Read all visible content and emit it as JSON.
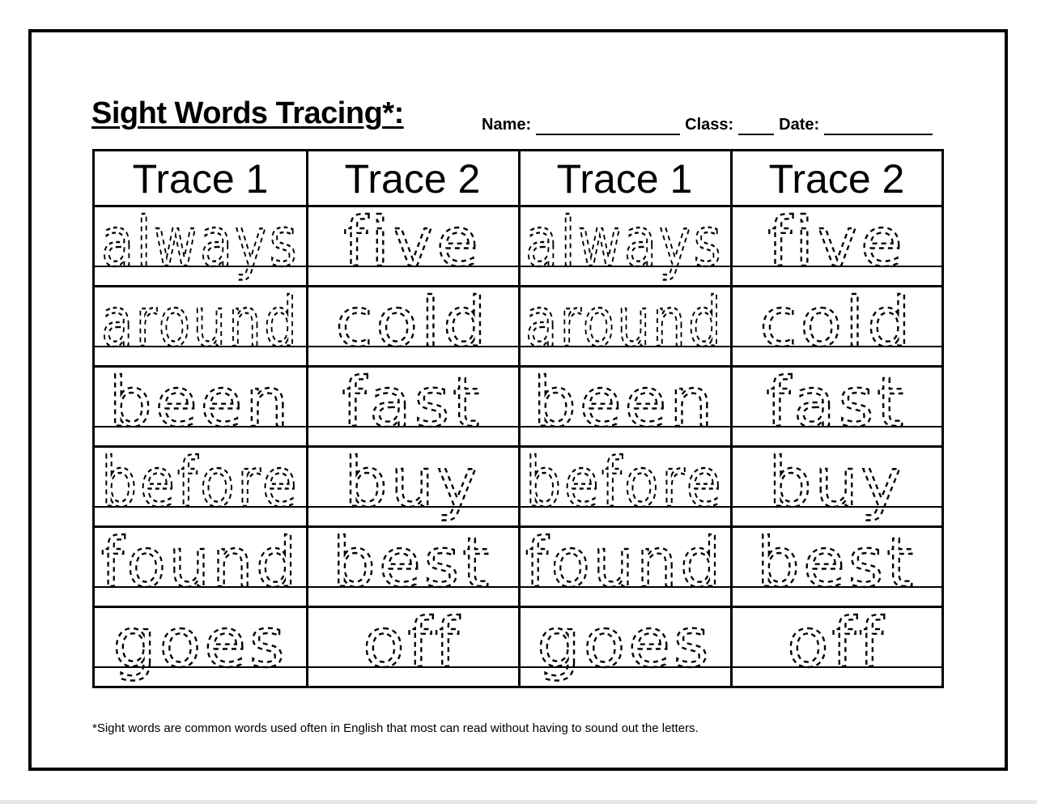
{
  "worksheet": {
    "title": "Sight Words Tracing*:",
    "name_label": "Name:",
    "class_label": "Class:",
    "date_label": "Date:",
    "column_headers": [
      "Trace 1",
      "Trace 2",
      "Trace 1",
      "Trace 2"
    ],
    "words": [
      [
        "always",
        "five"
      ],
      [
        "around",
        "cold"
      ],
      [
        "been",
        "fast"
      ],
      [
        "before",
        "buy"
      ],
      [
        "found",
        "best"
      ],
      [
        "goes",
        "off"
      ]
    ],
    "footnote": "*Sight words are common words used often in English that most can read without having to sound out the letters."
  }
}
